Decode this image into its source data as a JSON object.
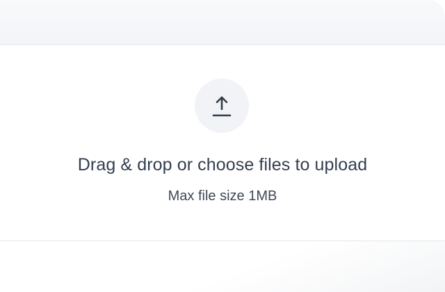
{
  "upload": {
    "title": "Drag & drop or choose files to upload",
    "subtitle": "Max file size 1MB",
    "icon": "upload-icon"
  },
  "colors": {
    "text_primary": "#343e4f",
    "text_secondary": "#3f4857",
    "icon_bg": "#f2f3f6",
    "divider": "#e4e6ea"
  }
}
